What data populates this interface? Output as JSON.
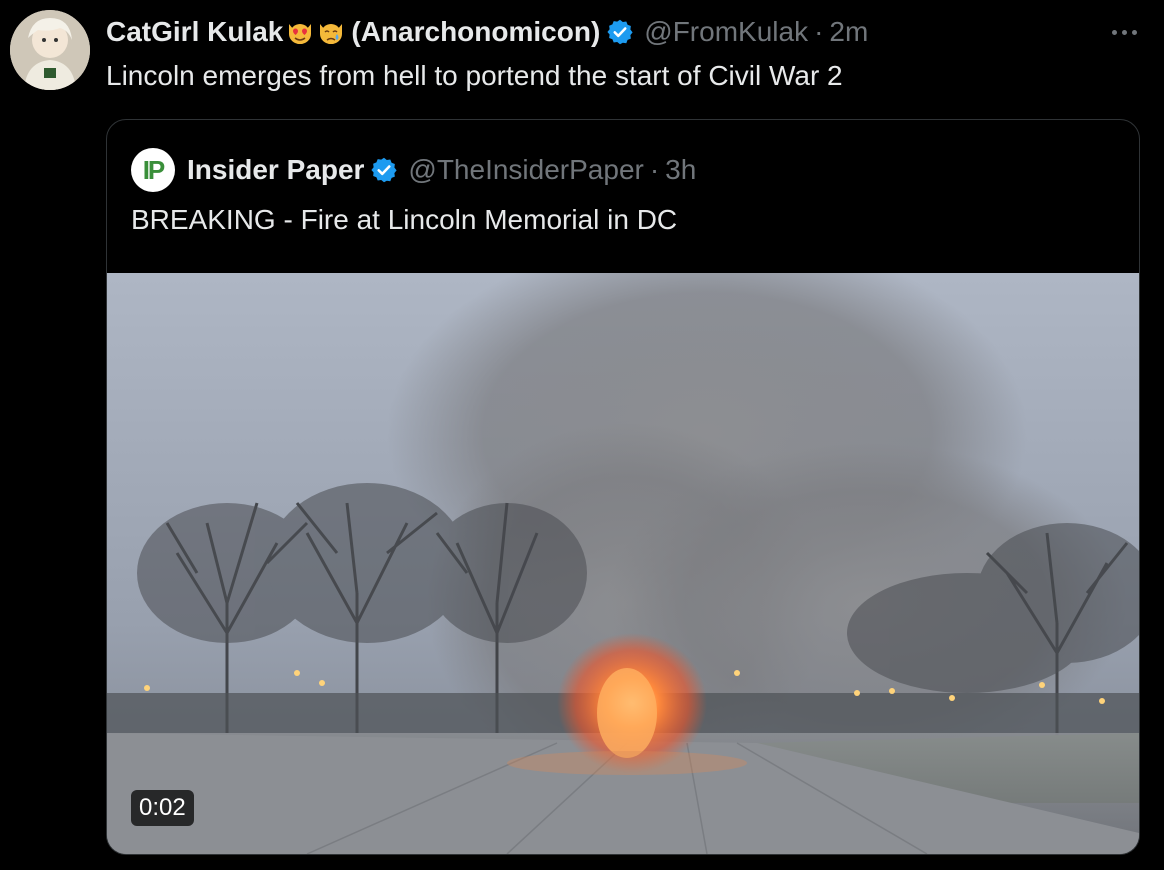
{
  "tweet": {
    "display_name": "CatGirl Kulak",
    "display_name_suffix": "(Anarchonomicon)",
    "emoji_1": "heart-eyes-cat-emoji",
    "emoji_2": "crying-cat-emoji",
    "handle": "@FromKulak",
    "separator": "·",
    "time": "2m",
    "text": "Lincoln emerges from hell to portend the start of Civil War 2",
    "verified": true
  },
  "quoted": {
    "display_name": "Insider Paper",
    "avatar_label": "IP",
    "handle": "@TheInsiderPaper",
    "separator": "·",
    "time": "3h",
    "text": "BREAKING - Fire at Lincoln Memorial in DC",
    "verified": true,
    "video": {
      "duration_label": "0:02"
    }
  },
  "icons": {
    "more": "more-horizontal-icon",
    "verified": "verified-badge-icon"
  },
  "colors": {
    "background": "#000000",
    "text": "#e7e9ea",
    "muted": "#71767b",
    "verified": "#1d9bf0",
    "border": "#2f3336"
  }
}
